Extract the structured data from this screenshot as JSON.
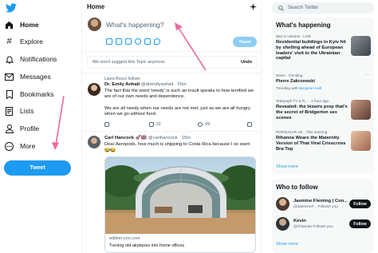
{
  "sidebar": {
    "items": [
      {
        "label": "Home"
      },
      {
        "label": "Explore"
      },
      {
        "label": "Notifications"
      },
      {
        "label": "Messages"
      },
      {
        "label": "Bookmarks"
      },
      {
        "label": "Lists"
      },
      {
        "label": "Profile"
      },
      {
        "label": "More"
      }
    ],
    "tweet_label": "Tweet"
  },
  "main": {
    "title": "Home",
    "composer": {
      "placeholder": "What's happening?",
      "tweet_label": "Tweet"
    },
    "notice": {
      "text": "We won't suggest this Topic anymore.",
      "undo": "Undo"
    },
    "follow_note": "Laura Bosco follows",
    "tweets": [
      {
        "name": "Dr. Emily Anhalt",
        "handle": "@dremilyanhalt · 55m",
        "text1": "The fact that the word 'needy' is such an insult speaks to how terrified we are of our own needs and dependence.",
        "text2": "We are all needy when our needs are not met, just as we are all hungry when we go without food.",
        "replies": "",
        "retweets": "22",
        "likes": "99"
      },
      {
        "name": "Carl Hancock 🚀🇬🇧",
        "handle": "@carlhancock · 15m",
        "text": "Dear Aeropods, how much is shipping to Costa Rica because I so want one.",
        "emoji": "😂😂",
        "card_domain": "edition.cnn.com",
        "card_title": "Turning old airplanes into home offices"
      }
    ]
  },
  "right": {
    "search_placeholder": "Search Twitter",
    "happening_title": "What's happening",
    "trends": [
      {
        "meta": "War in Ukraine · LIVE",
        "title": "Residential buildings in Kyiv hit by shelling ahead of European leaders' visit to the Ukrainian capital"
      },
      {
        "meta": "News · Trending",
        "title": "Pierre Zakrzewski",
        "sub_prefix": "Trending with ",
        "sub_link": "Benjamin Hall"
      },
      {
        "meta": "Telegraph TV & R... · 1 hour ago",
        "title": "Revealed: the bizarre prop that's the secret of Bridgerton sex scenes"
      },
      {
        "meta": "POPSUGAR UK · This morning",
        "title": "Rihanna Wears the Maternity Version of That Viral Crisscross Bra Top"
      }
    ],
    "show_more": "Show more",
    "wtf_title": "Who to follow",
    "follows": [
      {
        "name": "Jasmine Fleming | Con...",
        "handle": "@JasmineF... Follows you",
        "btn": "Follow"
      },
      {
        "name": "Kevin",
        "handle": "@chiaman  Follows you",
        "btn": "Follow"
      }
    ],
    "show_more_2": "Show more"
  },
  "colors": {
    "accent": "#1d9bf0",
    "annotation_arrow": "#f0679e",
    "text": "#0f1419",
    "muted": "#536471"
  }
}
